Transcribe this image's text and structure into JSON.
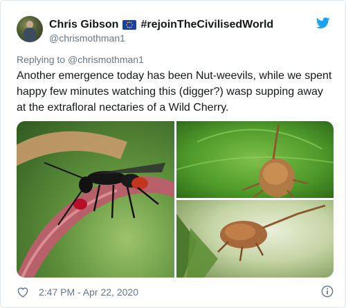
{
  "author": {
    "display_name": "Chris Gibson",
    "flag_icon": "eu-flag-icon",
    "tag": "#rejoinTheCivilisedWorld",
    "handle": "@chrismothman1"
  },
  "reply": {
    "prefix": "Replying to ",
    "handle": "@chrismothman1"
  },
  "tweet": {
    "text": "Another emergence today has been Nut-weevils, while we spent happy few minutes watching this (digger?) wasp supping away at the extrafloral nectaries of a Wild Cherry."
  },
  "media": {
    "photos": [
      {
        "name": "wasp-on-cherry-stem-photo"
      },
      {
        "name": "nut-weevil-on-leaf-photo"
      },
      {
        "name": "nut-weevil-on-plant-photo"
      }
    ]
  },
  "footer": {
    "timestamp": "2:47 PM - Apr 22, 2020",
    "like_icon": "heart-icon",
    "info_icon": "info-icon"
  },
  "colors": {
    "brand": "#1da1f2",
    "secondary_text": "#657786",
    "eu_blue": "#1b3fa8",
    "eu_gold": "#ffcc00"
  }
}
